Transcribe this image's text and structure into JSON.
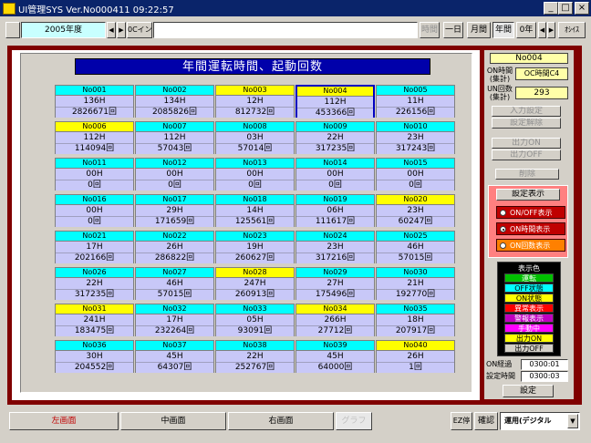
{
  "window": {
    "title": "UI管理SYS  Ver.No000411     09:22:57",
    "minimize": "_",
    "maximize": "□",
    "close": "×"
  },
  "toolbar": {
    "year_field": "2005年度",
    "left_arrow": "◀",
    "right_arrow": "▶",
    "onoff_button": "0Cイン",
    "time_button": "時間",
    "day_button": "一日",
    "month_button": "月間",
    "year_button": "年間",
    "zero_year_button": "0年",
    "prev_button": "◀",
    "next_button": "▶",
    "oc_button": "ｵｼｲｽ"
  },
  "main": {
    "banner": "年間運転時間、起動回数",
    "cells": [
      {
        "no": "No001",
        "color": "#00ffff",
        "time": "136H",
        "count": "2826671回"
      },
      {
        "no": "No002",
        "color": "#00ffff",
        "time": "134H",
        "count": "2085826回"
      },
      {
        "no": "No003",
        "color": "#ffff00",
        "time": "12H",
        "count": "812732回"
      },
      {
        "no": "No004",
        "color": "#ffff00",
        "time": "112H",
        "count": "453366回",
        "selected": true
      },
      {
        "no": "No005",
        "color": "#00ffff",
        "time": "11H",
        "count": "226156回"
      },
      {
        "no": "No006",
        "color": "#ffff00",
        "time": "112H",
        "count": "114094回"
      },
      {
        "no": "No007",
        "color": "#00ffff",
        "time": "112H",
        "count": "57043回"
      },
      {
        "no": "No008",
        "color": "#00ffff",
        "time": "03H",
        "count": "57014回"
      },
      {
        "no": "No009",
        "color": "#00ffff",
        "time": "22H",
        "count": "317235回"
      },
      {
        "no": "No010",
        "color": "#00ffff",
        "time": "23H",
        "count": "317243回"
      },
      {
        "no": "No011",
        "color": "#00ffff",
        "time": "00H",
        "count": "0回"
      },
      {
        "no": "No012",
        "color": "#00ffff",
        "time": "00H",
        "count": "0回"
      },
      {
        "no": "No013",
        "color": "#00ffff",
        "time": "00H",
        "count": "0回"
      },
      {
        "no": "No014",
        "color": "#00ffff",
        "time": "00H",
        "count": "0回"
      },
      {
        "no": "No015",
        "color": "#00ffff",
        "time": "00H",
        "count": "0回"
      },
      {
        "no": "No016",
        "color": "#00ffff",
        "time": "00H",
        "count": "0回"
      },
      {
        "no": "No017",
        "color": "#00ffff",
        "time": "29H",
        "count": "171659回"
      },
      {
        "no": "No018",
        "color": "#00ffff",
        "time": "14H",
        "count": "125561回"
      },
      {
        "no": "No019",
        "color": "#00ffff",
        "time": "06H",
        "count": "111617回"
      },
      {
        "no": "No020",
        "color": "#ffff00",
        "time": "23H",
        "count": "60247回"
      },
      {
        "no": "No021",
        "color": "#00ffff",
        "time": "17H",
        "count": "202166回"
      },
      {
        "no": "No022",
        "color": "#00ffff",
        "time": "26H",
        "count": "286822回"
      },
      {
        "no": "No023",
        "color": "#00ffff",
        "time": "19H",
        "count": "260627回"
      },
      {
        "no": "No024",
        "color": "#00ffff",
        "time": "23H",
        "count": "317216回"
      },
      {
        "no": "No025",
        "color": "#00ffff",
        "time": "46H",
        "count": "57015回"
      },
      {
        "no": "No026",
        "color": "#00ffff",
        "time": "22H",
        "count": "317235回"
      },
      {
        "no": "No027",
        "color": "#00ffff",
        "time": "46H",
        "count": "57015回"
      },
      {
        "no": "No028",
        "color": "#ffff00",
        "time": "247H",
        "count": "260913回"
      },
      {
        "no": "No029",
        "color": "#00ffff",
        "time": "27H",
        "count": "175496回"
      },
      {
        "no": "No030",
        "color": "#00ffff",
        "time": "21H",
        "count": "192770回"
      },
      {
        "no": "No031",
        "color": "#ffff00",
        "time": "241H",
        "count": "183475回"
      },
      {
        "no": "No032",
        "color": "#00ffff",
        "time": "17H",
        "count": "232264回"
      },
      {
        "no": "No033",
        "color": "#00ffff",
        "time": "05H",
        "count": "93091回"
      },
      {
        "no": "No034",
        "color": "#ffff00",
        "time": "266H",
        "count": "27712回"
      },
      {
        "no": "No035",
        "color": "#00ffff",
        "time": "18H",
        "count": "207917回"
      },
      {
        "no": "No036",
        "color": "#00ffff",
        "time": "30H",
        "count": "204552回"
      },
      {
        "no": "No037",
        "color": "#00ffff",
        "time": "45H",
        "count": "64307回"
      },
      {
        "no": "No038",
        "color": "#00ffff",
        "time": "22H",
        "count": "252767回"
      },
      {
        "no": "No039",
        "color": "#00ffff",
        "time": "45H",
        "count": "64000回"
      },
      {
        "no": "No040",
        "color": "#ffff00",
        "time": "26H",
        "count": "1回"
      }
    ]
  },
  "side": {
    "selected_no": "No004",
    "on_label": "ON時間(集計)",
    "on_value": "OC時間C4",
    "un_label": "UN回数(集計)",
    "un_value": "293",
    "input_settings": "入力設定",
    "input_release": "設定解除",
    "output_on": "出力ON",
    "output_off": "出力OFF",
    "delete": "削除",
    "display_settings": "設定表示",
    "opt1": "ON/OFF表示",
    "opt2": "ON時間表示",
    "opt3": "ON回数表示",
    "legend_title": "表示色",
    "legend": [
      {
        "label": "運転",
        "bg": "#00c000",
        "fg": "#ffffff"
      },
      {
        "label": "OFF状態",
        "bg": "#00ffff",
        "fg": "#000000"
      },
      {
        "label": "ON状態",
        "bg": "#ffff00",
        "fg": "#000000"
      },
      {
        "label": "異常表示",
        "bg": "#ff0000",
        "fg": "#ffffff"
      },
      {
        "label": "警報表示",
        "bg": "#c000c0",
        "fg": "#ffffff"
      },
      {
        "label": "手動中",
        "bg": "#ff00ff",
        "fg": "#ffffff"
      },
      {
        "label": "出力ON",
        "bg": "#ffff00",
        "fg": "#000000"
      },
      {
        "label": "出力OFF",
        "bg": "#d4d0c8",
        "fg": "#000000"
      }
    ],
    "on_delay_label": "ON経過",
    "on_delay_value": "0300:01",
    "set_time_label": "設定時間",
    "set_time_value": "0300:03",
    "set_button": "設定"
  },
  "bottom": {
    "left_tab": "左画面",
    "center_tab": "中画面",
    "right_tab": "右画面",
    "graph_tab": "グラフ",
    "ez_button": "EZ停",
    "confirm_button": "確認",
    "mode_select": "運用(デジタル"
  }
}
